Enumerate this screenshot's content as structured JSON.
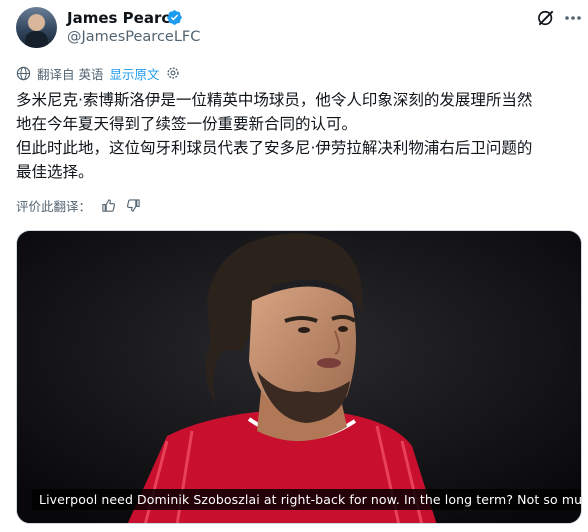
{
  "author": {
    "display_name": "James Pearce",
    "handle": "@JamesPearceLFC",
    "verified_color": "#1d9bf0"
  },
  "translation": {
    "translated_from": "翻译自 英语",
    "show_original": "显示原文"
  },
  "tweet": {
    "lines": [
      "多米尼克·索博斯洛伊是一位精英中场球员，他令人印象深刻的发展理所当然",
      "地在今年夏天得到了续签一份重要新合同的认可。",
      "但此时此地，这位匈牙利球员代表了安多尼·伊劳拉解决利物浦右后卫问题的",
      "最佳选择。"
    ]
  },
  "rating": {
    "label": "评价此翻译："
  },
  "media": {
    "caption": "Liverpool need Dominik Szoboszlai at right-back for now. In the long term? Not so much"
  },
  "icons": [
    "verified-badge-icon",
    "grok-icon",
    "more-icon",
    "translate-globe-icon",
    "settings-gear-icon",
    "thumbs-up-icon",
    "thumbs-down-icon"
  ],
  "colors": {
    "link": "#1d9bf0",
    "text": "#0f1419",
    "muted": "#536471",
    "jersey": "#c8102e"
  }
}
